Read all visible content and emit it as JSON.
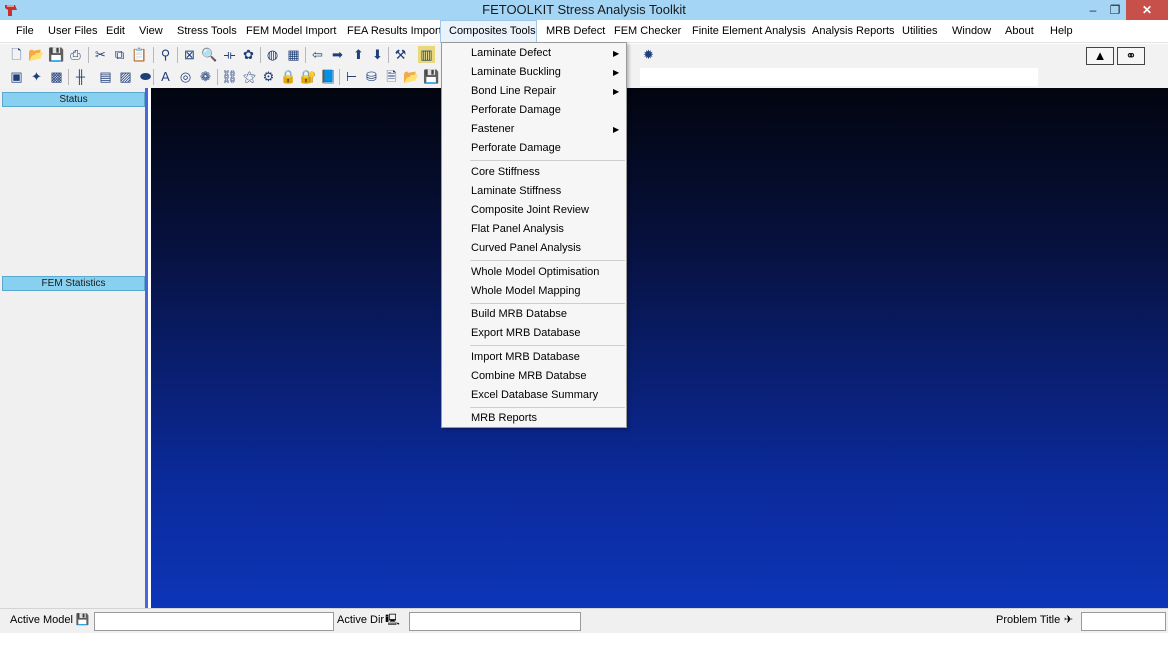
{
  "window": {
    "title": "FETOOLKIT Stress Analysis Toolkit",
    "minimize_glyph": "–",
    "restore_glyph": "❐",
    "close_glyph": "✕"
  },
  "menubar": [
    {
      "label": "File"
    },
    {
      "label": "User Files"
    },
    {
      "label": "Edit"
    },
    {
      "label": "View"
    },
    {
      "label": "Stress Tools"
    },
    {
      "label": "FEM Model Import"
    },
    {
      "label": "FEA Results Import"
    },
    {
      "label": "Composites Tools"
    },
    {
      "label": "MRB Defect"
    },
    {
      "label": "FEM  Checker"
    },
    {
      "label": "Finite Element Analysis"
    },
    {
      "label": "Analysis Reports"
    },
    {
      "label": "Utilities"
    },
    {
      "label": "Window"
    },
    {
      "label": "About"
    },
    {
      "label": "Help"
    }
  ],
  "dropdown": {
    "items": [
      {
        "label": "Laminate Defect",
        "submenu": true
      },
      {
        "label": "Laminate Buckling",
        "submenu": true
      },
      {
        "label": "Bond Line Repair",
        "submenu": true
      },
      {
        "label": "Perforate Damage",
        "submenu": false
      },
      {
        "label": "Fastener",
        "submenu": true
      },
      {
        "label": "Perforate Damage",
        "submenu": false
      },
      {
        "label": "Core Stiffness",
        "submenu": false
      },
      {
        "label": "Laminate Stiffness",
        "submenu": false
      },
      {
        "label": "Composite Joint Review",
        "submenu": false
      },
      {
        "label": "Flat Panel Analysis",
        "submenu": false
      },
      {
        "label": "Curved Panel Analysis",
        "submenu": false
      },
      {
        "label": "Whole Model Optimisation",
        "submenu": false
      },
      {
        "label": "Whole Model Mapping",
        "submenu": false
      },
      {
        "label": "Build MRB Databse",
        "submenu": false
      },
      {
        "label": "Export MRB Database",
        "submenu": false
      },
      {
        "label": "Import MRB Database",
        "submenu": false
      },
      {
        "label": "Combine MRB Databse",
        "submenu": false
      },
      {
        "label": "Excel Database Summary",
        "submenu": false
      },
      {
        "label": "MRB Reports",
        "submenu": false
      }
    ],
    "submenu_arrow": "▶"
  },
  "toolbar1": [
    {
      "name": "new-file-icon",
      "glyph": "🗋"
    },
    {
      "name": "open-folder-icon",
      "glyph": "📂"
    },
    {
      "name": "save-icon",
      "glyph": "💾"
    },
    {
      "name": "print-icon",
      "glyph": "⎙"
    },
    {
      "name": "cut-icon",
      "glyph": "✂"
    },
    {
      "name": "copy-icon",
      "glyph": "⧉"
    },
    {
      "name": "paste-icon",
      "glyph": "📋"
    },
    {
      "name": "find-icon",
      "glyph": "⚲"
    },
    {
      "name": "zoom-window-icon",
      "glyph": "⊠"
    },
    {
      "name": "zoom-icon",
      "glyph": "🔍"
    },
    {
      "name": "measure-icon",
      "glyph": "⟛"
    },
    {
      "name": "mesh-icon",
      "glyph": "✿"
    },
    {
      "name": "sphere-icon",
      "glyph": "◍"
    },
    {
      "name": "calculator-icon",
      "glyph": "▦"
    },
    {
      "name": "arrow-left-icon",
      "glyph": "⇦"
    },
    {
      "name": "arrow-right-icon",
      "glyph": "➡"
    },
    {
      "name": "arrow-up-icon",
      "glyph": "⬆"
    },
    {
      "name": "arrow-down-icon",
      "glyph": "⬇"
    },
    {
      "name": "tools-dropdown-icon",
      "glyph": "⚒"
    },
    {
      "name": "chart-icon",
      "glyph": "▥"
    }
  ],
  "toolbar1_extra": [
    {
      "name": "sun-icon",
      "glyph": "✹"
    }
  ],
  "toolbar1_right": [
    {
      "name": "warning-triangle-icon",
      "glyph": "▲"
    },
    {
      "name": "binoculars-icon",
      "glyph": "⚭"
    }
  ],
  "toolbar2": [
    {
      "name": "select-box-icon",
      "glyph": "▣"
    },
    {
      "name": "node-icon",
      "glyph": "✦"
    },
    {
      "name": "element-icon",
      "glyph": "▩"
    },
    {
      "name": "beam-icon",
      "glyph": "╫"
    },
    {
      "name": "grid-icon",
      "glyph": "▤"
    },
    {
      "name": "image-icon",
      "glyph": "▨"
    },
    {
      "name": "ellipse-icon",
      "glyph": "⬬"
    },
    {
      "name": "text-icon",
      "glyph": "A"
    },
    {
      "name": "target-icon",
      "glyph": "◎"
    },
    {
      "name": "group-icon",
      "glyph": "❁"
    },
    {
      "name": "link-icon",
      "glyph": "⛓"
    },
    {
      "name": "network-icon",
      "glyph": "⚝"
    },
    {
      "name": "gear-icon",
      "glyph": "⚙"
    },
    {
      "name": "lock-icon",
      "glyph": "🔒"
    },
    {
      "name": "locked-icon",
      "glyph": "🔐"
    },
    {
      "name": "book-icon",
      "glyph": "📘"
    },
    {
      "name": "tree-icon",
      "glyph": "⊢"
    },
    {
      "name": "database-icon",
      "glyph": "⛁"
    },
    {
      "name": "document-icon",
      "glyph": "🗎"
    },
    {
      "name": "open-icon",
      "glyph": "📂"
    },
    {
      "name": "save-as-icon",
      "glyph": "💾"
    }
  ],
  "leftpanel": {
    "status_header": "Status",
    "fem_stats_header": "FEM Statistics"
  },
  "statusbar": {
    "active_model_label": "Active Model",
    "active_model_value": "",
    "active_dir_label": "Active Dir",
    "active_dir_value": "",
    "problem_title_label": "Problem Title",
    "problem_title_value": "",
    "save_glyph": "💾",
    "computer_glyph": "🖳",
    "plane_glyph": "✈"
  }
}
